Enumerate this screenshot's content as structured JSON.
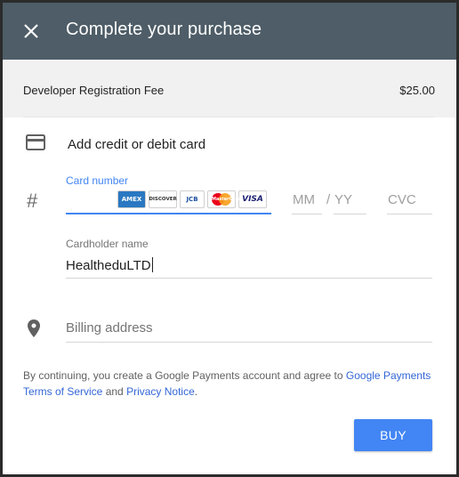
{
  "header": {
    "title": "Complete your purchase",
    "close_icon": "close-icon"
  },
  "order": {
    "item_label": "Developer Registration Fee",
    "amount": "$25.00"
  },
  "payment": {
    "add_card_label": "Add credit or debit card",
    "card_number": {
      "label": "Card number",
      "value": ""
    },
    "card_logos": [
      "AMEX",
      "DISCOVER",
      "JCB",
      "MasterCard",
      "VISA"
    ],
    "expiry_month": {
      "placeholder": "MM"
    },
    "expiry_separator": "/",
    "expiry_year": {
      "placeholder": "YY"
    },
    "cvc": {
      "placeholder": "CVC"
    },
    "cardholder": {
      "label": "Cardholder name",
      "value": "HealtheduLTD"
    },
    "billing": {
      "placeholder": "Billing address"
    }
  },
  "terms": {
    "prefix": "By continuing, you create a Google Payments account and agree to ",
    "tos_link": "Google Payments Terms of Service",
    "middle": " and ",
    "privacy_link": "Privacy Notice",
    "suffix": "."
  },
  "actions": {
    "buy_label": "BUY"
  },
  "colors": {
    "header_bg": "#4e5d67",
    "accent": "#4285f4",
    "link": "#3367d6"
  }
}
